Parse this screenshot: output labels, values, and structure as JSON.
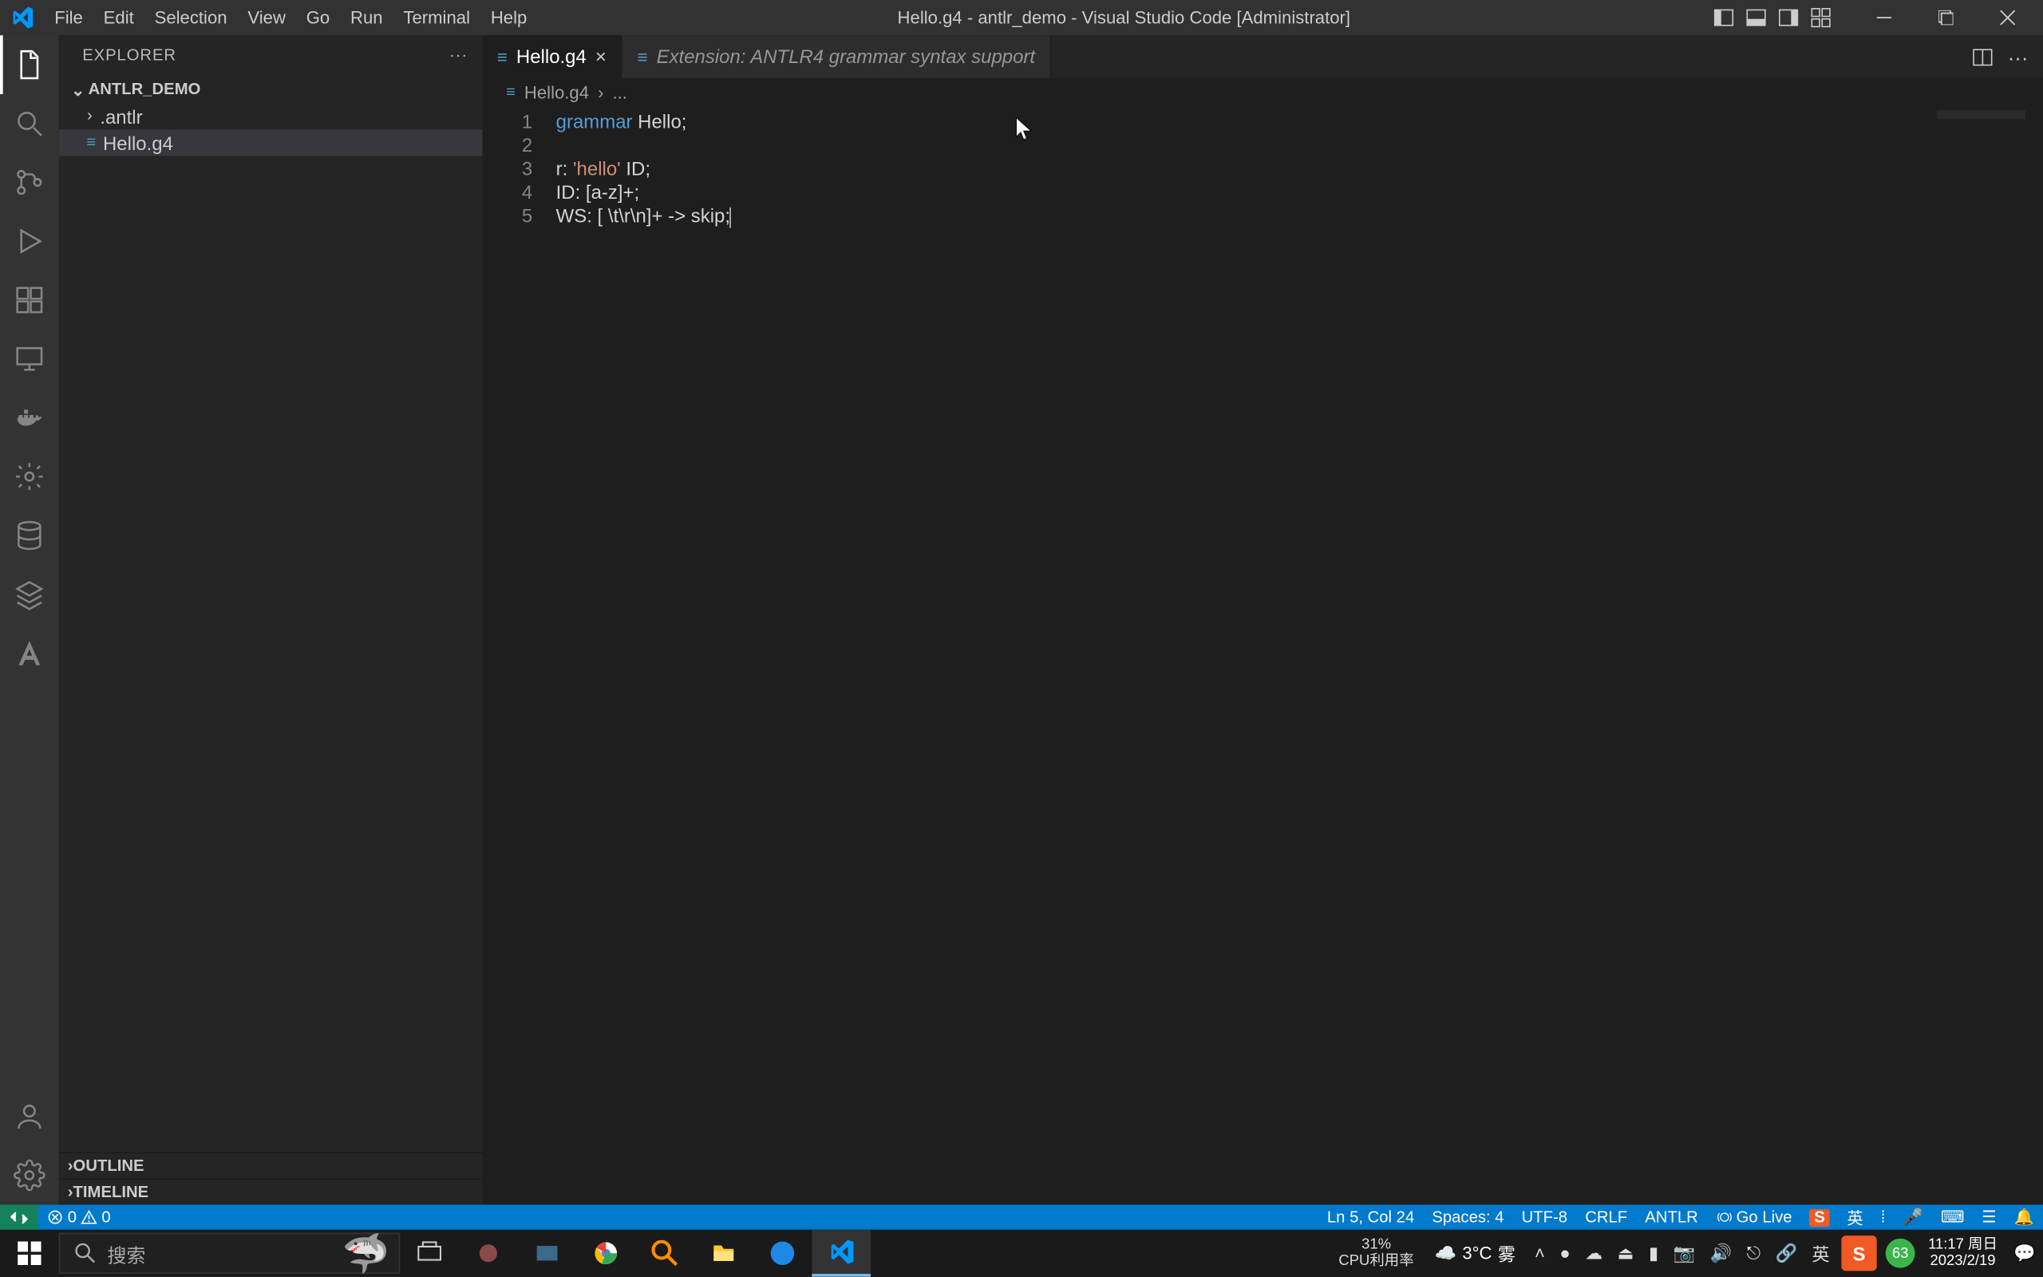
{
  "titlebar": {
    "title": "Hello.g4 - antlr_demo - Visual Studio Code [Administrator]",
    "menus": [
      "File",
      "Edit",
      "Selection",
      "View",
      "Go",
      "Run",
      "Terminal",
      "Help"
    ]
  },
  "sidebar": {
    "header": "EXPLORER",
    "folder": "ANTLR_DEMO",
    "items": [
      {
        "name": ".antlr",
        "type": "folder"
      },
      {
        "name": "Hello.g4",
        "type": "file",
        "selected": true
      }
    ],
    "outline": "OUTLINE",
    "timeline": "TIMELINE"
  },
  "tabs": [
    {
      "label": "Hello.g4",
      "active": true
    },
    {
      "label": "Extension: ANTLR4 grammar syntax support",
      "active": false,
      "italic": true
    }
  ],
  "breadcrumb": {
    "file": "Hello.g4",
    "sep": "›",
    "rest": "..."
  },
  "code": {
    "lines": [
      {
        "n": "1",
        "tokens": [
          {
            "t": "grammar",
            "c": "kw"
          },
          {
            "t": " Hello;",
            "c": "id"
          }
        ]
      },
      {
        "n": "2",
        "tokens": []
      },
      {
        "n": "3",
        "tokens": [
          {
            "t": "r: ",
            "c": "id"
          },
          {
            "t": "'hello'",
            "c": "str"
          },
          {
            "t": " ID;",
            "c": "id"
          }
        ]
      },
      {
        "n": "4",
        "tokens": [
          {
            "t": "ID: [a-z]+;",
            "c": "id"
          }
        ]
      },
      {
        "n": "5",
        "tokens": [
          {
            "t": "WS: [ \\t\\r\\n]+ -> skip;",
            "c": "id"
          }
        ],
        "cursor": true
      }
    ]
  },
  "statusbar": {
    "errors": "0",
    "warnings": "0",
    "position": "Ln 5, Col 24",
    "spaces": "Spaces: 4",
    "encoding": "UTF-8",
    "eol": "CRLF",
    "lang": "ANTLR",
    "golive": "Go Live"
  },
  "taskbar": {
    "search_placeholder": "搜索",
    "weather_temp": "3°C",
    "weather_cond": "雾",
    "cpu_pct": "31%",
    "cpu_label": "CPU利用率",
    "ime_lang": "英",
    "ime_s": "S",
    "time": "11:17 周日",
    "date": "2023/2/19",
    "badge63": "63"
  }
}
